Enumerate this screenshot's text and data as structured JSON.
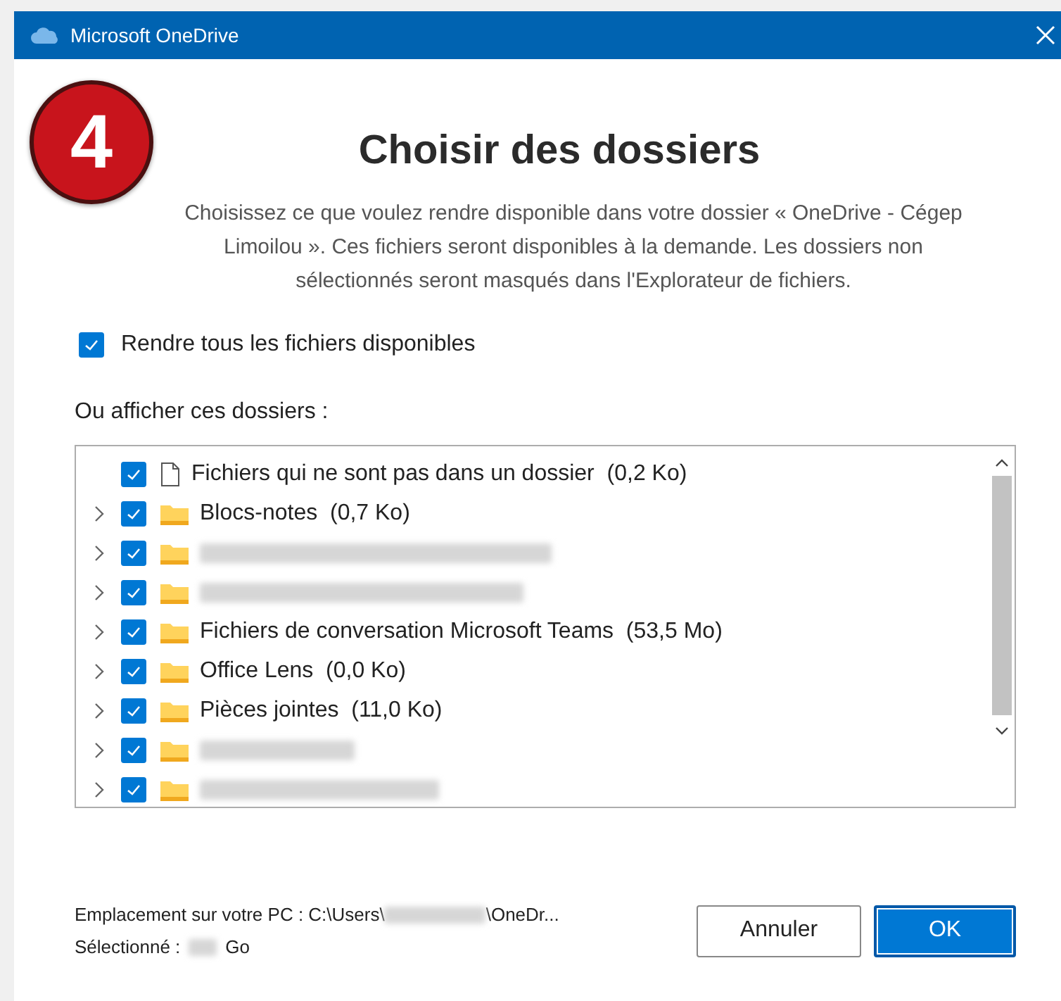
{
  "window": {
    "title": "Microsoft OneDrive"
  },
  "step_badge": "4",
  "heading": "Choisir des dossiers",
  "description": "Choisissez ce que voulez rendre disponible dans votre dossier « OneDrive - Cégep Limoilou ». Ces fichiers seront disponibles à la demande. Les dossiers non sélectionnés seront masqués dans l'Explorateur de fichiers.",
  "make_all_available": {
    "label": "Rendre tous les fichiers disponibles",
    "checked": true
  },
  "list_label": "Ou afficher ces dossiers :",
  "folders": [
    {
      "kind": "file",
      "name": "Fichiers qui ne sont pas dans un dossier",
      "size": "(0,2 Ko)",
      "checked": true
    },
    {
      "kind": "folder",
      "name": "Blocs-notes",
      "size": "(0,7 Ko)",
      "checked": true,
      "expanded": false
    },
    {
      "kind": "redacted",
      "checked": true,
      "expanded": false
    },
    {
      "kind": "redacted",
      "checked": true,
      "expanded": false
    },
    {
      "kind": "folder",
      "name": "Fichiers de conversation Microsoft Teams",
      "size": "(53,5 Mo)",
      "checked": true,
      "expanded": false
    },
    {
      "kind": "folder",
      "name": "Office Lens",
      "size": "(0,0 Ko)",
      "checked": true,
      "expanded": false
    },
    {
      "kind": "folder",
      "name": "Pièces jointes",
      "size": "(11,0 Ko)",
      "checked": true,
      "expanded": false
    },
    {
      "kind": "redacted",
      "checked": true,
      "expanded": false
    },
    {
      "kind": "redacted",
      "checked": true,
      "expanded": false
    }
  ],
  "footer": {
    "location_label": "Emplacement sur votre PC : C:\\Users\\",
    "location_tail": "\\OneDr...",
    "selected_label": "Sélectionné :",
    "selected_unit": "Go"
  },
  "buttons": [
    {
      "label": "Annuler",
      "kind": "secondary"
    },
    {
      "label": "OK",
      "kind": "primary"
    }
  ]
}
